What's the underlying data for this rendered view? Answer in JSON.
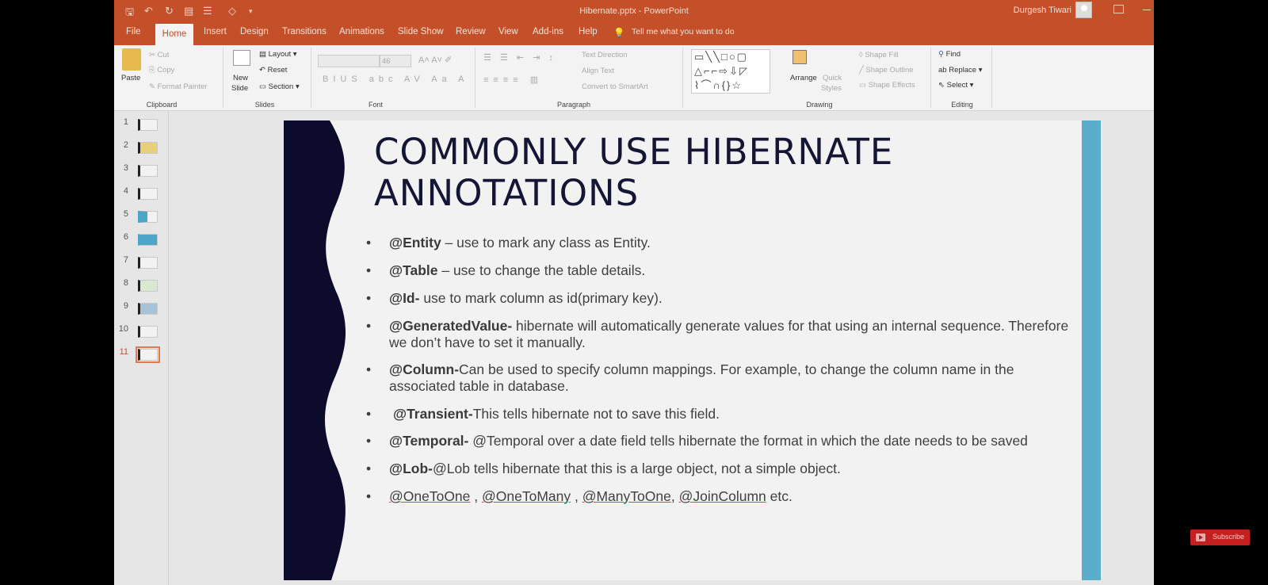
{
  "titlebar": {
    "doc_title": "Hibernate.pptx  -  PowerPoint",
    "user": "Durgesh Tiwari",
    "accent": "#c4502a"
  },
  "tabs": [
    "File",
    "Home",
    "Insert",
    "Design",
    "Transitions",
    "Animations",
    "Slide Show",
    "Review",
    "View",
    "Add-ins",
    "Help"
  ],
  "tell_me": "Tell me what you want to do",
  "ribbon": {
    "clipboard": {
      "paste": "Paste",
      "cut": "Cut",
      "copy": "Copy",
      "format_painter": "Format Painter",
      "label": "Clipboard"
    },
    "slides": {
      "new_slide": "New",
      "new_slide2": "Slide",
      "layout": "Layout",
      "reset": "Reset",
      "section": "Section",
      "label": "Slides"
    },
    "font": {
      "size": "46",
      "label": "Font"
    },
    "paragraph": {
      "text_direction": "Text Direction",
      "align_text": "Align Text",
      "convert_smartart": "Convert to SmartArt",
      "label": "Paragraph"
    },
    "drawing": {
      "arrange": "Arrange",
      "quick_styles": "Quick",
      "quick_styles2": "Styles",
      "shape_fill": "Shape Fill",
      "shape_outline": "Shape Outline",
      "shape_effects": "Shape Effects",
      "label": "Drawing"
    },
    "editing": {
      "find": "Find",
      "replace": "Replace",
      "select": "Select",
      "label": "Editing"
    }
  },
  "thumbnails": [
    "1",
    "2",
    "3",
    "4",
    "5",
    "6",
    "7",
    "8",
    "9",
    "10",
    "11"
  ],
  "active_slide": 11,
  "slide": {
    "title_line1": "COMMONLY USE HIBERNATE",
    "title_line2": "ANNOTATIONS",
    "bullets": [
      {
        "bold": "@Entity",
        "text": " – use to mark any class as Entity."
      },
      {
        "bold": "@Table",
        "text": " – use to change the table details."
      },
      {
        "bold": "@Id-",
        "text": " use to mark column as id(primary key)."
      },
      {
        "bold": "@GeneratedValue-",
        "text": " hibernate will automatically generate values for that using an internal sequence. Therefore we don’t have to set it manually."
      },
      {
        "bold": "@Column-",
        "text": "Can be used to specify column mappings. For example, to change the column name in the associated table in database."
      },
      {
        "bold": "@Transient-",
        "text": "This tells hibernate not to save this field."
      },
      {
        "bold": "@Temporal-",
        "text": " @Temporal over a date field tells hibernate the format in which the date needs to be saved"
      },
      {
        "bold": "@Lob-",
        "text": "@Lob tells hibernate that this is a large object, not a simple object."
      }
    ],
    "last_bullet": {
      "a": "@OneToOne",
      "b": "@OneToMany",
      "c": "@ManyToOne",
      "d": "@JoinColumn",
      "sep1": " ,  ",
      "sep2": " ,  ",
      "sep3": ", ",
      "tail": " etc."
    },
    "colors": {
      "dark": "#0c0b2c",
      "blue": "#5aaecb"
    }
  },
  "overlay": {
    "subscribe": "Subscribe"
  }
}
